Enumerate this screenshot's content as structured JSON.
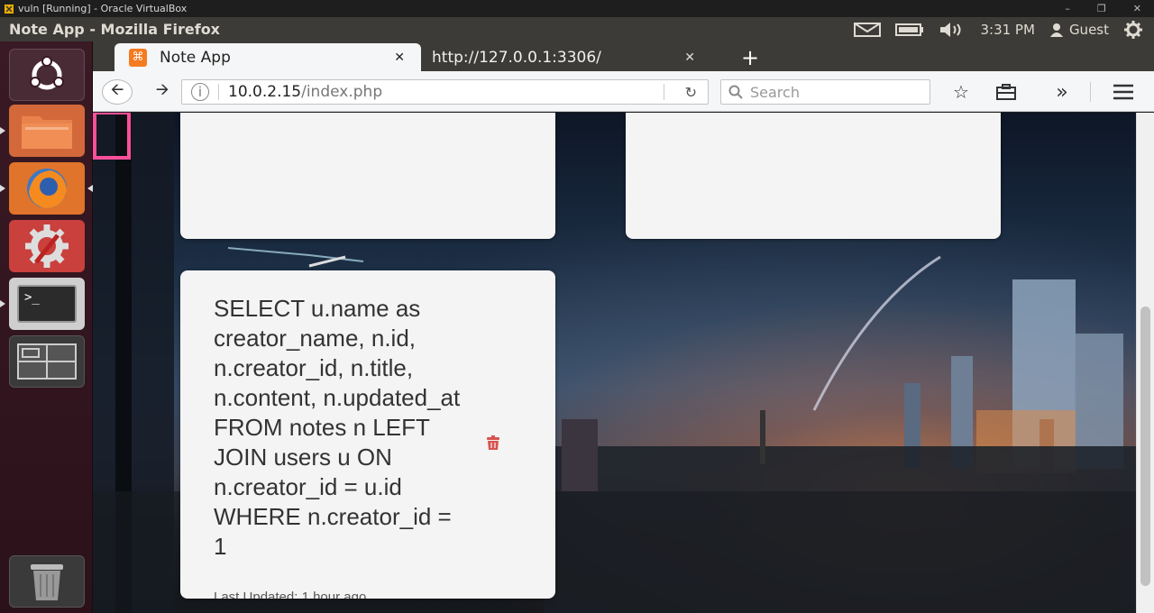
{
  "vbox": {
    "title": "vuln [Running] - Oracle VirtualBox"
  },
  "panel": {
    "window_title": "Note App - Mozilla Firefox",
    "time": "3:31 PM",
    "user": "Guest"
  },
  "launcher": {
    "items": [
      "ubuntu-dash",
      "files",
      "firefox",
      "system-settings",
      "terminal",
      "workspace-switcher",
      "trash"
    ]
  },
  "browser": {
    "tabs": [
      {
        "label": "Note App",
        "active": true
      },
      {
        "label": "http://127.0.0.1:3306/",
        "active": false
      }
    ],
    "url_host": "10.0.2.15",
    "url_path": "/index.php",
    "search_placeholder": "Search"
  },
  "notes": {
    "third": {
      "text": "SELECT u.name as creator_name, n.id, n.creator_id, n.title, n.content, n.updated_at FROM notes n LEFT JOIN users u ON n.creator_id = u.id WHERE n.creator_id = 1",
      "meta": "Last Updated: 1 hour ago"
    }
  },
  "colors": {
    "accent_tab_icon": "#f47b20",
    "trash_icon": "#d9534f"
  }
}
